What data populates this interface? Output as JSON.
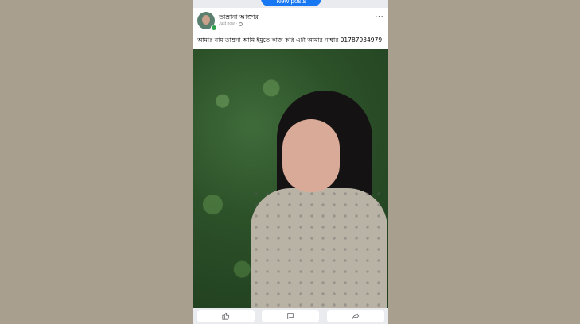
{
  "feed": {
    "new_posts_label": "New posts"
  },
  "post": {
    "author": "তাম্রানা আক্তার",
    "timestamp": "Just now",
    "caption": "আমার নাম তাম্রনা আমি ইমুতে কাজ করি এটা আমার নাম্বার 01787934979",
    "more_icon": "⋯",
    "privacy_icon": "globe-icon"
  },
  "actions": {
    "like_icon": "thumbs-up-icon",
    "comment_icon": "comment-icon",
    "share_icon": "share-icon"
  }
}
